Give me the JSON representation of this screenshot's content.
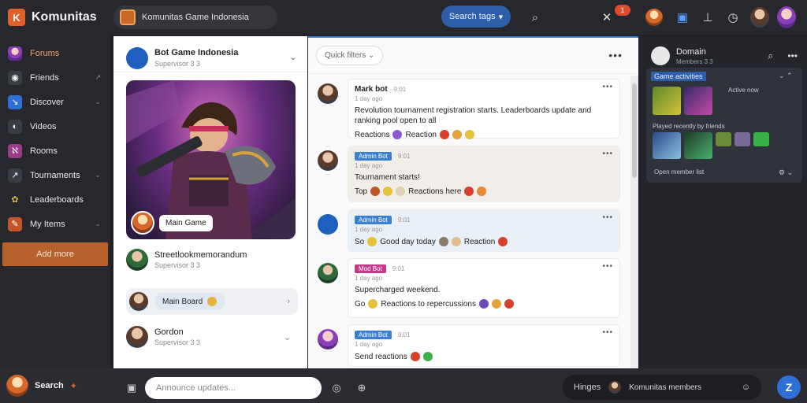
{
  "app": {
    "name": "Komunitas"
  },
  "header": {
    "group_name": "Komunitas Game Indonesia",
    "search_label": "Search tags",
    "notif_count": "1"
  },
  "sidebar": {
    "items": [
      {
        "label": "Forums",
        "icon": "avatar-icon",
        "color": "#d07ac0"
      },
      {
        "label": "Friends",
        "icon": "compass-icon",
        "color": "#3a3d44"
      },
      {
        "label": "Discover",
        "icon": "chart-icon",
        "color": "#2e6fd8"
      },
      {
        "label": "Videos",
        "icon": "camera-icon",
        "color": "#3a3d44"
      },
      {
        "label": "Rooms",
        "icon": "bars-icon",
        "color": "#9b3c8a"
      },
      {
        "label": "Tournaments",
        "icon": "arrow-icon",
        "color": "#3a3d44"
      },
      {
        "label": "Leaderboards",
        "icon": "trophy-icon",
        "color": "#3a3d44"
      },
      {
        "label": "My Items",
        "icon": "pencil-icon",
        "color": "#c2562a"
      }
    ],
    "cta_label": "Add more"
  },
  "left_panel": {
    "author": "Bot Game Indonesia",
    "author_sub": "Supervisor 3 3",
    "hero_caption": "Main Game",
    "row1_title": "Streetlookmemorandum",
    "row1_sub": "Supervisor 3 3",
    "chip_label": "Main Board",
    "row2_title": "Gordon",
    "row2_sub": "Supervisor 3 3"
  },
  "chat": {
    "filter_label": "Quick filters",
    "messages": [
      {
        "user": "Mark bot",
        "time": "9:01",
        "sub": "1 day ago",
        "text": "Revolution tournament registration starts. Leaderboards update and ranking pool open to all",
        "reacts_label": "Reactions",
        "reacts_text": "Reaction"
      },
      {
        "user": "Admin Bot",
        "time": "9:01",
        "sub": "1 day ago",
        "text": "Tournament starts!",
        "reacts_label": "Top",
        "reacts_text": "Reactions here"
      },
      {
        "user": "Admin Bot",
        "time": "9:01",
        "sub": "1 day ago",
        "text": "",
        "reacts_label": "So",
        "reacts_text": "Good day today",
        "reacts_tail": "Reaction"
      },
      {
        "user": "Mod Bot",
        "time": "9:01",
        "sub": "1 day ago",
        "text": "Supercharged weekend.",
        "reacts_label": "Go",
        "reacts_text": "Reactions to repercussions"
      },
      {
        "user": "Admin Bot",
        "time": "9:01",
        "sub": "1 day ago",
        "text": "",
        "reacts_label": "Send",
        "reacts_text": "Send reactions"
      }
    ]
  },
  "right_panel": {
    "title": "Domain",
    "sub": "Members 3 3",
    "card_title": "Game activities",
    "card_sub1": "Active now",
    "card_sub2": "Played recently by friends",
    "footer": "Open member list"
  },
  "bottom": {
    "me_name": "Search",
    "compose_placeholder": "Announce updates...",
    "dm_label": "Hinges",
    "dm_who": "Komunitas members"
  },
  "colors": {
    "accent": "#2e5ea8",
    "brand": "#e0602a",
    "cta": "#b8612c"
  }
}
